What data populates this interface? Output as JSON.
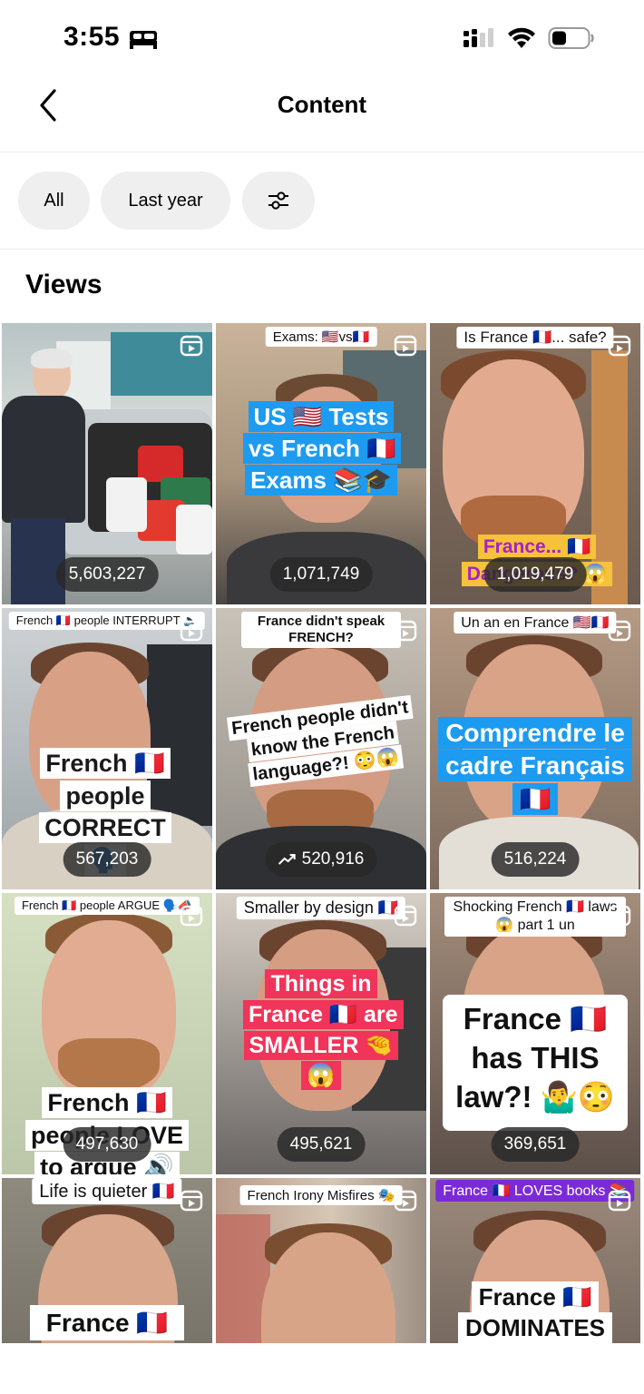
{
  "status_bar": {
    "time": "3:55"
  },
  "header": {
    "title": "Content"
  },
  "filters": {
    "all_label": "All",
    "period_label": "Last year"
  },
  "section": {
    "title": "Views"
  },
  "tiles": [
    {
      "top_caption": "",
      "caption": "",
      "views": "5,603,227"
    },
    {
      "top_caption": "Exams: 🇺🇸vs🇫🇷",
      "caption": "US 🇺🇸 Tests vs French 🇫🇷 Exams 📚🎓",
      "views": "1,071,749"
    },
    {
      "top_caption": "Is France 🇫🇷... safe?",
      "caption": "France... 🇫🇷 Dangerous? 😱",
      "views": "1,019,479"
    },
    {
      "top_caption": "French 🇫🇷 people INTERRUPT 🔈",
      "caption": "French 🇫🇷 people CORRECT 🗣️",
      "views": "567,203"
    },
    {
      "top_caption": "France didn't speak FRENCH?",
      "caption": "French people didn't know the French language?! 😳😱",
      "views": "520,916"
    },
    {
      "top_caption": "Un an en France 🇺🇸🇫🇷",
      "caption": "Comprendre le cadre Français 🇫🇷",
      "views": "516,224"
    },
    {
      "top_caption": "French 🇫🇷 people ARGUE 🗣️📣",
      "caption": "French 🇫🇷 people LOVE to argue 🔊",
      "views": "497,630"
    },
    {
      "top_caption": "Smaller by design 🇫🇷",
      "caption": "Things in France 🇫🇷 are SMALLER 🤏😱",
      "views": "495,621"
    },
    {
      "top_caption": "Shocking French 🇫🇷 laws 😱 part 1 un",
      "caption": "France 🇫🇷 has THIS law?! 🤷‍♂️😳",
      "views": "369,651"
    },
    {
      "top_caption": "Life is quieter 🇫🇷",
      "caption": "France 🇫🇷",
      "views": ""
    },
    {
      "top_caption": "French Irony Misfires 🎭",
      "caption": "",
      "views": ""
    },
    {
      "top_caption": "France 🇫🇷 LOVES books 📚",
      "caption": "France 🇫🇷 DOMINATES",
      "views": ""
    }
  ]
}
